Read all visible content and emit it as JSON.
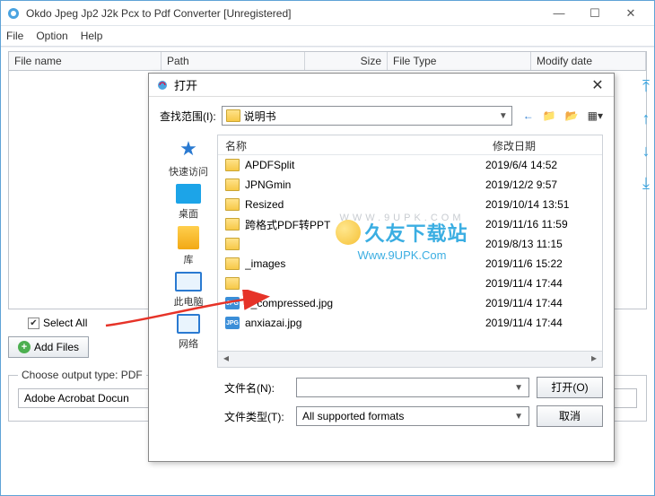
{
  "window": {
    "title": "Okdo Jpeg Jp2 J2k Pcx to Pdf Converter [Unregistered]"
  },
  "menu": {
    "file": "File",
    "option": "Option",
    "help": "Help"
  },
  "columns": {
    "filename": "File name",
    "path": "Path",
    "size": "Size",
    "filetype": "File Type",
    "modify": "Modify date"
  },
  "select_all_label": "Select All",
  "add_files_label": "Add Files",
  "output": {
    "legend": "Choose output type:  PDF",
    "field_text": "Adobe Acrobat Docun"
  },
  "dialog": {
    "title": "打开",
    "look_in_label": "查找范围(I):",
    "look_in_value": "说明书",
    "places": {
      "quick": "快速访问",
      "desktop": "桌面",
      "lib": "库",
      "pc": "此电脑",
      "net": "网络"
    },
    "header": {
      "name": "名称",
      "date": "修改日期"
    },
    "files": [
      {
        "type": "folder",
        "name": "APDFSplit",
        "date": "2019/6/4 14:52"
      },
      {
        "type": "folder",
        "name": "JPNGmin",
        "date": "2019/12/2 9:57"
      },
      {
        "type": "folder",
        "name": "Resized",
        "date": "2019/10/14 13:51"
      },
      {
        "type": "folder",
        "name": "跨格式PDF转PPT",
        "date": "2019/11/16 11:59"
      },
      {
        "type": "folder",
        "name": "",
        "date": "2019/8/13 11:15"
      },
      {
        "type": "folder",
        "name": "_images",
        "date": "2019/11/6 15:22"
      },
      {
        "type": "folder",
        "name": "",
        "date": "2019/11/4 17:44"
      },
      {
        "type": "jpg",
        "name": "1_compressed.jpg",
        "date": "2019/11/4 17:44"
      },
      {
        "type": "jpg",
        "name": "anxiazai.jpg",
        "date": "2019/11/4 17:44"
      }
    ],
    "filename_label": "文件名(N):",
    "filename_value": "",
    "filetype_label": "文件类型(T):",
    "filetype_value": "All supported formats",
    "open_btn": "打开(O)",
    "cancel_btn": "取消"
  },
  "watermark": {
    "line1": "久友下载站",
    "line2": "Www.9UPK.Com",
    "faint": "WWW.9UPK.COM"
  }
}
